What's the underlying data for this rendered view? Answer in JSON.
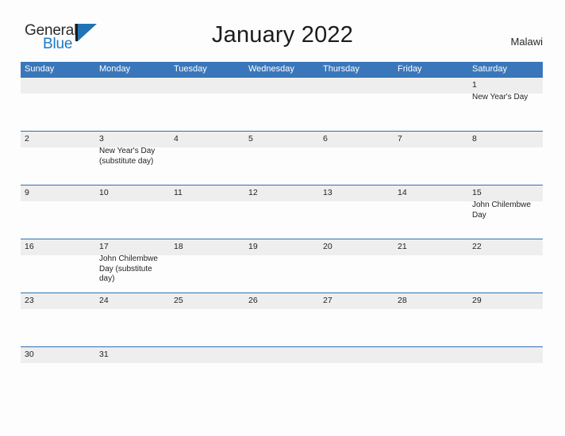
{
  "brand": {
    "name_part1": "General",
    "name_part2": "Blue",
    "flag_icon": "general-blue-flag-icon"
  },
  "header": {
    "title": "January 2022",
    "country": "Malawi",
    "accent_color": "#3a77ba",
    "stripe_color": "#eeeeee",
    "rule_color": "#2f6fb0"
  },
  "calendar": {
    "weekday_headers": [
      "Sunday",
      "Monday",
      "Tuesday",
      "Wednesday",
      "Thursday",
      "Friday",
      "Saturday"
    ],
    "weeks": [
      [
        {
          "day": "",
          "event": ""
        },
        {
          "day": "",
          "event": ""
        },
        {
          "day": "",
          "event": ""
        },
        {
          "day": "",
          "event": ""
        },
        {
          "day": "",
          "event": ""
        },
        {
          "day": "",
          "event": ""
        },
        {
          "day": "1",
          "event": "New Year's Day"
        }
      ],
      [
        {
          "day": "2",
          "event": ""
        },
        {
          "day": "3",
          "event": "New Year's Day (substitute day)"
        },
        {
          "day": "4",
          "event": ""
        },
        {
          "day": "5",
          "event": ""
        },
        {
          "day": "6",
          "event": ""
        },
        {
          "day": "7",
          "event": ""
        },
        {
          "day": "8",
          "event": ""
        }
      ],
      [
        {
          "day": "9",
          "event": ""
        },
        {
          "day": "10",
          "event": ""
        },
        {
          "day": "11",
          "event": ""
        },
        {
          "day": "12",
          "event": ""
        },
        {
          "day": "13",
          "event": ""
        },
        {
          "day": "14",
          "event": ""
        },
        {
          "day": "15",
          "event": "John Chilembwe Day"
        }
      ],
      [
        {
          "day": "16",
          "event": ""
        },
        {
          "day": "17",
          "event": "John Chilembwe Day (substitute day)"
        },
        {
          "day": "18",
          "event": ""
        },
        {
          "day": "19",
          "event": ""
        },
        {
          "day": "20",
          "event": ""
        },
        {
          "day": "21",
          "event": ""
        },
        {
          "day": "22",
          "event": ""
        }
      ],
      [
        {
          "day": "23",
          "event": ""
        },
        {
          "day": "24",
          "event": ""
        },
        {
          "day": "25",
          "event": ""
        },
        {
          "day": "26",
          "event": ""
        },
        {
          "day": "27",
          "event": ""
        },
        {
          "day": "28",
          "event": ""
        },
        {
          "day": "29",
          "event": ""
        }
      ],
      [
        {
          "day": "30",
          "event": ""
        },
        {
          "day": "31",
          "event": ""
        },
        {
          "day": "",
          "event": ""
        },
        {
          "day": "",
          "event": ""
        },
        {
          "day": "",
          "event": ""
        },
        {
          "day": "",
          "event": ""
        },
        {
          "day": "",
          "event": ""
        }
      ]
    ]
  }
}
